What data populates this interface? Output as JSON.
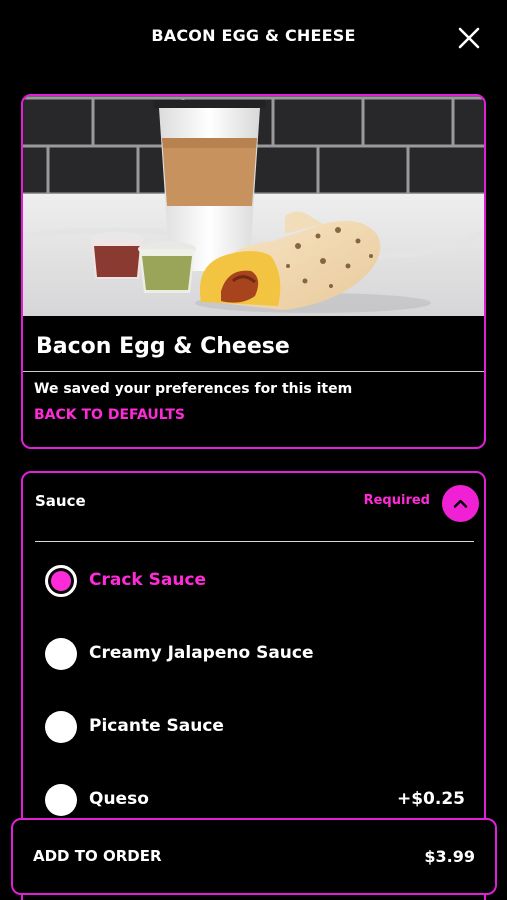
{
  "header": {
    "title": "BACON EGG & CHEESE",
    "close_icon": "close-icon"
  },
  "product": {
    "name": "Bacon Egg & Cheese",
    "image": "breakfast-burrito-with-coffee-and-salsas",
    "saved_message": "We saved your preferences for this item",
    "reset_link": "BACK TO DEFAULTS"
  },
  "sauce_section": {
    "title": "Sauce",
    "required_label": "Required",
    "toggle_icon": "chevron-up-icon",
    "options": [
      {
        "label": "Crack Sauce",
        "selected": true,
        "price": ""
      },
      {
        "label": "Creamy Jalapeno Sauce",
        "selected": false,
        "price": ""
      },
      {
        "label": "Picante Sauce",
        "selected": false,
        "price": ""
      },
      {
        "label": "Queso",
        "selected": false,
        "price": "+$0.25"
      }
    ]
  },
  "footer": {
    "add_label": "ADD TO ORDER",
    "total": "$3.99"
  },
  "colors": {
    "accent": "#ff2ad8",
    "border": "#e020d8",
    "background": "#000000",
    "text": "#ffffff"
  }
}
